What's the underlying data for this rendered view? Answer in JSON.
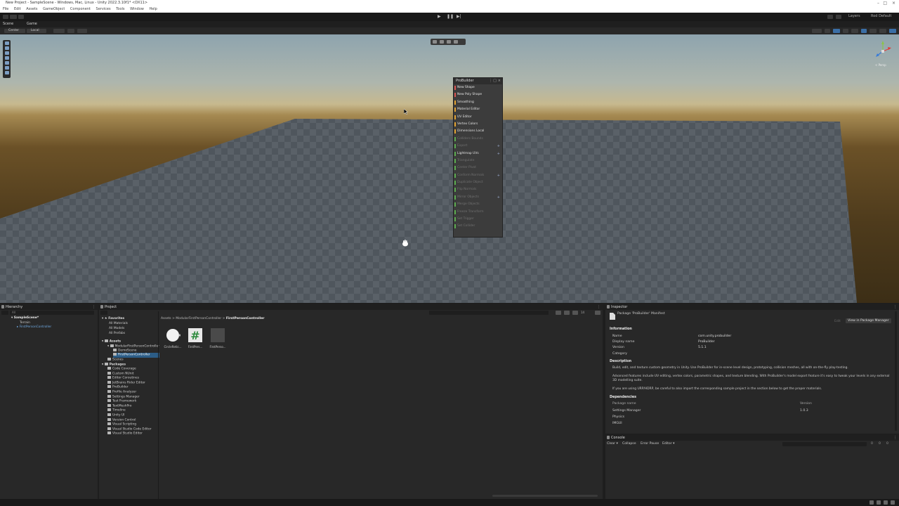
{
  "titlebar": {
    "title": "New Project - SampleScene - Windows, Mac, Linux - Unity 2022.3.10f1* <DX11>",
    "minimize": "–",
    "maximize": "□",
    "close": "×"
  },
  "menu": [
    "File",
    "Edit",
    "Assets",
    "GameObject",
    "Component",
    "Services",
    "Tools",
    "Window",
    "Help"
  ],
  "toolbar": {
    "play": "▶",
    "pause": "❚❚",
    "step": "▶|",
    "layers": "Layers",
    "layout": "Rod Default"
  },
  "scene_tabs": {
    "scene": "Scene",
    "game": "Game"
  },
  "scene_toolbar": {
    "pivot": "Center",
    "space": "Local"
  },
  "gizmo": {
    "persp": "< Persp"
  },
  "probuilder": {
    "title": "ProBuilder",
    "items": [
      {
        "label": "New Shape",
        "color": "#d9534f",
        "enabled": true,
        "plus": false
      },
      {
        "label": "New Poly Shape",
        "color": "#d9534f",
        "enabled": true,
        "plus": false
      },
      {
        "label": "Smoothing",
        "color": "#e0a030",
        "enabled": true,
        "plus": false
      },
      {
        "label": "Material Editor",
        "color": "#e0a030",
        "enabled": true,
        "plus": false
      },
      {
        "label": "UV Editor",
        "color": "#e0a030",
        "enabled": true,
        "plus": false
      },
      {
        "label": "Vertex Colors",
        "color": "#e0a030",
        "enabled": true,
        "plus": false
      },
      {
        "label": "Dimensions Local",
        "color": "#e0a030",
        "enabled": true,
        "plus": false
      },
      {
        "label": "Colliders Bounds",
        "color": "#5aaa4e",
        "enabled": false,
        "plus": false
      },
      {
        "label": "Export",
        "color": "#5aaa4e",
        "enabled": false,
        "plus": true
      },
      {
        "label": "Lightmap UVs",
        "color": "#5aaa4e",
        "enabled": true,
        "plus": true
      },
      {
        "label": "Triangulate",
        "color": "#5aaa4e",
        "enabled": false,
        "plus": false
      },
      {
        "label": "Center Pivot",
        "color": "#5aaa4e",
        "enabled": false,
        "plus": false
      },
      {
        "label": "Conform Normals",
        "color": "#5aaa4e",
        "enabled": false,
        "plus": true
      },
      {
        "label": "Duplicate Object",
        "color": "#5aaa4e",
        "enabled": false,
        "plus": false
      },
      {
        "label": "Flip Normals",
        "color": "#5aaa4e",
        "enabled": false,
        "plus": false
      },
      {
        "label": "Mirror Objects",
        "color": "#5aaa4e",
        "enabled": false,
        "plus": true
      },
      {
        "label": "Merge Objects",
        "color": "#5aaa4e",
        "enabled": false,
        "plus": false
      },
      {
        "label": "Freeze Transform",
        "color": "#5aaa4e",
        "enabled": false,
        "plus": false
      },
      {
        "label": "Set Trigger",
        "color": "#5aaa4e",
        "enabled": false,
        "plus": false
      },
      {
        "label": "Set Collider",
        "color": "#5aaa4e",
        "enabled": false,
        "plus": false
      }
    ]
  },
  "hierarchy": {
    "tab": "Hierarchy",
    "search_placeholder": "All",
    "scene": "SampleScene*",
    "children": [
      "Terrain",
      "FirstPersonController"
    ]
  },
  "project": {
    "tab": "Project",
    "breadcrumb": [
      "Assets",
      "ModularFirstPersonController",
      "FirstPersonController"
    ],
    "favorites_label": "Favorites",
    "favorites": [
      "All Materials",
      "All Models",
      "All Prefabs"
    ],
    "assets_label": "Assets",
    "asset_tree": [
      "ModularFirstPersonController",
      "DemoScene",
      "FirstPersonController",
      "Scenes"
    ],
    "packages_label": "Packages",
    "packages": [
      "Code Coverage",
      "Custom NUnit",
      "Editor Coroutines",
      "JetBrains Rider Editor",
      "ProBuilder",
      "Profile Analyzer",
      "Settings Manager",
      "Test Framework",
      "TextMeshPro",
      "Timeline",
      "Unity UI",
      "Version Control",
      "Visual Scripting",
      "Visual Studio Code Editor",
      "Visual Studio Editor"
    ],
    "assets": [
      {
        "name": "CircleRetic...",
        "type": "circle"
      },
      {
        "name": "FirstPers...",
        "type": "script"
      },
      {
        "name": "FirstPerso...",
        "type": "prefab"
      }
    ],
    "hidden_count": "14"
  },
  "inspector": {
    "tab": "Inspector",
    "header": "Package 'ProBuilder' Manifest",
    "edit_label": "Edit",
    "view_button": "View in Package Manager",
    "information_label": "Information",
    "fields": [
      {
        "label": "Name",
        "value": "com.unity.probuilder"
      },
      {
        "label": "Display name",
        "value": "ProBuilder"
      },
      {
        "label": "Version",
        "value": "5.1.1"
      },
      {
        "label": "Category",
        "value": ""
      }
    ],
    "description_label": "Description",
    "description": [
      "Build, edit, and texture custom geometry in Unity. Use ProBuilder for in-scene level design, prototyping, collision meshes, all with on-the-fly play-testing.",
      "Advanced features include UV editing, vertex colors, parametric shapes, and texture blending. With ProBuilder's model export feature it's easy to tweak your levels in any external 3D modelling suite.",
      "If you are using URP/HDRP, be careful to also import the corresponding sample project in the section below to get the proper materials."
    ],
    "dependencies_label": "Dependencies",
    "dep_headers": [
      "Package name",
      "Version"
    ],
    "dependencies": [
      {
        "name": "Settings Manager",
        "version": "1.0.3"
      },
      {
        "name": "Physics",
        "version": ""
      },
      {
        "name": "IMGUI",
        "version": ""
      }
    ]
  },
  "console": {
    "tab": "Console",
    "buttons": [
      "Clear",
      "Collapse",
      "Error Pause",
      "Editor"
    ],
    "counts": [
      "0",
      "0",
      "0"
    ]
  }
}
